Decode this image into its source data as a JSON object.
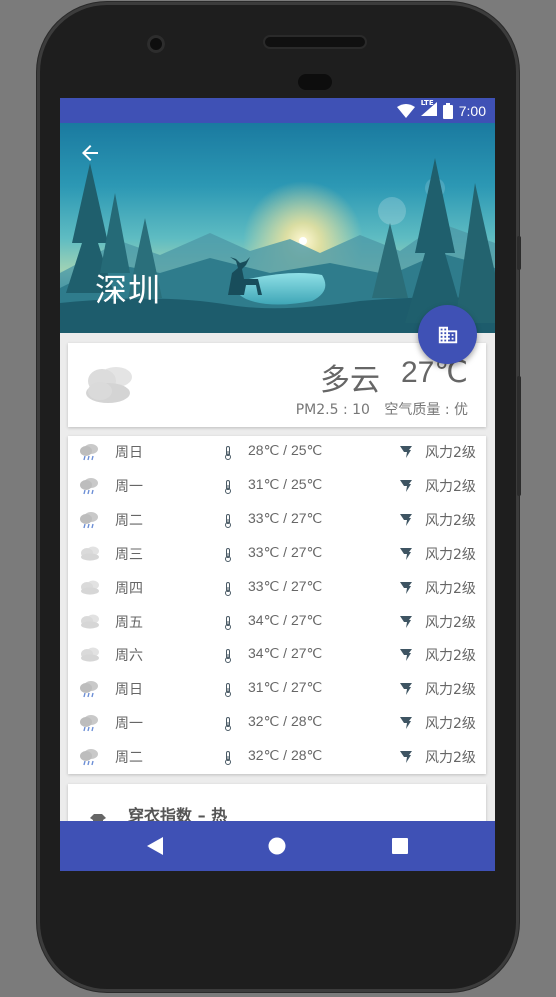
{
  "status_bar": {
    "time": "7:00",
    "network": "LTE"
  },
  "header": {
    "city": "深圳"
  },
  "current": {
    "condition": "多云",
    "temperature": "27℃",
    "pm25": "PM2.5 : 10",
    "air_quality": "空气质量 : 优",
    "icon": "cloudy-icon"
  },
  "forecast": [
    {
      "day": "周日",
      "temp": "28℃ / 25℃",
      "wind": "风力2级",
      "icon": "rain-icon"
    },
    {
      "day": "周一",
      "temp": "31℃ / 25℃",
      "wind": "风力2级",
      "icon": "rain-icon"
    },
    {
      "day": "周二",
      "temp": "33℃ / 27℃",
      "wind": "风力2级",
      "icon": "rain-icon"
    },
    {
      "day": "周三",
      "temp": "33℃ / 27℃",
      "wind": "风力2级",
      "icon": "cloudy-icon"
    },
    {
      "day": "周四",
      "temp": "33℃ / 27℃",
      "wind": "风力2级",
      "icon": "cloudy-icon"
    },
    {
      "day": "周五",
      "temp": "34℃ / 27℃",
      "wind": "风力2级",
      "icon": "cloudy-icon"
    },
    {
      "day": "周六",
      "temp": "34℃ / 27℃",
      "wind": "风力2级",
      "icon": "cloudy-icon"
    },
    {
      "day": "周日",
      "temp": "31℃ / 27℃",
      "wind": "风力2级",
      "icon": "rain-icon"
    },
    {
      "day": "周一",
      "temp": "32℃ / 28℃",
      "wind": "风力2级",
      "icon": "rain-icon"
    },
    {
      "day": "周二",
      "temp": "32℃ / 28℃",
      "wind": "风力2级",
      "icon": "rain-icon"
    }
  ],
  "index": {
    "title": "穿衣指数 – 热"
  },
  "colors": {
    "primary": "#3f51b5",
    "text": "#666666",
    "card": "#ffffff"
  }
}
